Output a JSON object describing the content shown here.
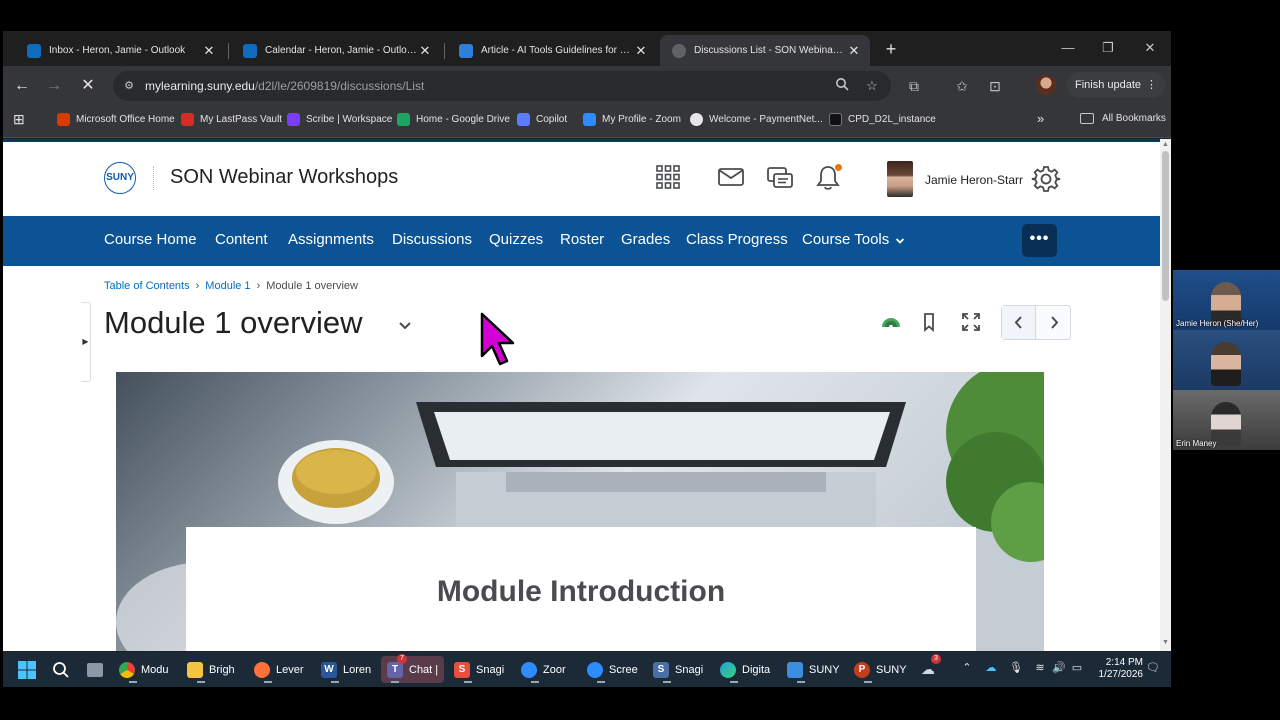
{
  "browser": {
    "tabs": [
      {
        "title": "Inbox - Heron, Jamie - Outlook",
        "color": "#0f6cbd"
      },
      {
        "title": "Calendar - Heron, Jamie - Outlook",
        "color": "#0f6cbd"
      },
      {
        "title": "Article - AI Tools Guidelines for SUN...",
        "color": "#2f7fd8"
      },
      {
        "title": "Discussions List - SON Webinar Works...",
        "color": "#5f6368"
      }
    ],
    "close_glyph": "✕",
    "new_tab_glyph": "+",
    "address_host": "mylearning.suny.edu",
    "address_path": "/d2l/le/2609819/discussions/List",
    "finish_update_label": "Finish update",
    "bookmarks": [
      {
        "label": "Microsoft Office Home",
        "color": "#d83b01"
      },
      {
        "label": "My LastPass Vault",
        "color": "#d32d27"
      },
      {
        "label": "Scribe | Workspace",
        "color": "#7a3cff"
      },
      {
        "label": "Home - Google Drive",
        "color": "#1fa463"
      },
      {
        "label": "Copilot",
        "color": "#5b7cff"
      },
      {
        "label": "My Profile - Zoom",
        "color": "#2d8cff"
      },
      {
        "label": "Welcome - PaymentNet...",
        "color": "#e6e6e6"
      },
      {
        "label": "CPD_D2L_instance",
        "color": "#111111"
      }
    ],
    "all_bookmarks_label": "All Bookmarks"
  },
  "site": {
    "logo_text": "SUNY",
    "course_title": "SON Webinar Workshops",
    "user_name": "Jamie Heron-Starr",
    "nav": [
      "Course Home",
      "Content",
      "Assignments",
      "Discussions",
      "Quizzes",
      "Roster",
      "Grades",
      "Class Progress",
      "Course Tools"
    ],
    "nav_more_label": "•••",
    "accent_color": "#0b5394"
  },
  "content": {
    "breadcrumb": [
      "Table of Contents",
      "Module 1",
      "Module 1 overview"
    ],
    "breadcrumb_sep": "›",
    "page_title": "Module 1 overview",
    "banner_heading": "Module Introduction"
  },
  "taskbar": {
    "apps": [
      {
        "label": "Modu",
        "icon": "chrome-icon",
        "color": "#fbbc04"
      },
      {
        "label": "Brigh",
        "icon": "folder-icon",
        "color": "#f4c542"
      },
      {
        "label": "Lever",
        "icon": "firefox-icon",
        "color": "#ff7139"
      },
      {
        "label": "Loren",
        "icon": "word-icon",
        "color": "#2b579a"
      },
      {
        "label": "Chat |",
        "icon": "teams-icon",
        "color": "#6264a7"
      },
      {
        "label": "Snagi",
        "icon": "snagit-icon",
        "color": "#e94e3c"
      },
      {
        "label": "Zoor",
        "icon": "zoom-icon",
        "color": "#2d8cff"
      },
      {
        "label": "Scree",
        "icon": "zoom-icon",
        "color": "#2d8cff"
      },
      {
        "label": "Snagi",
        "icon": "snagit-icon",
        "color": "#4a6fa5"
      },
      {
        "label": "Digita",
        "icon": "edge-icon",
        "color": "#1fa1d8"
      },
      {
        "label": "SUNY",
        "icon": "app-icon",
        "color": "#3b8ede"
      },
      {
        "label": "SUNY",
        "icon": "powerpoint-icon",
        "color": "#c43e1c"
      }
    ],
    "time": "2:14 PM",
    "date": "1/27/2026",
    "chat_badge": "7",
    "weather_badge": "3"
  },
  "video": {
    "participants": [
      "Jamie Heron (She/Her)",
      "",
      "Erin Maney"
    ]
  }
}
